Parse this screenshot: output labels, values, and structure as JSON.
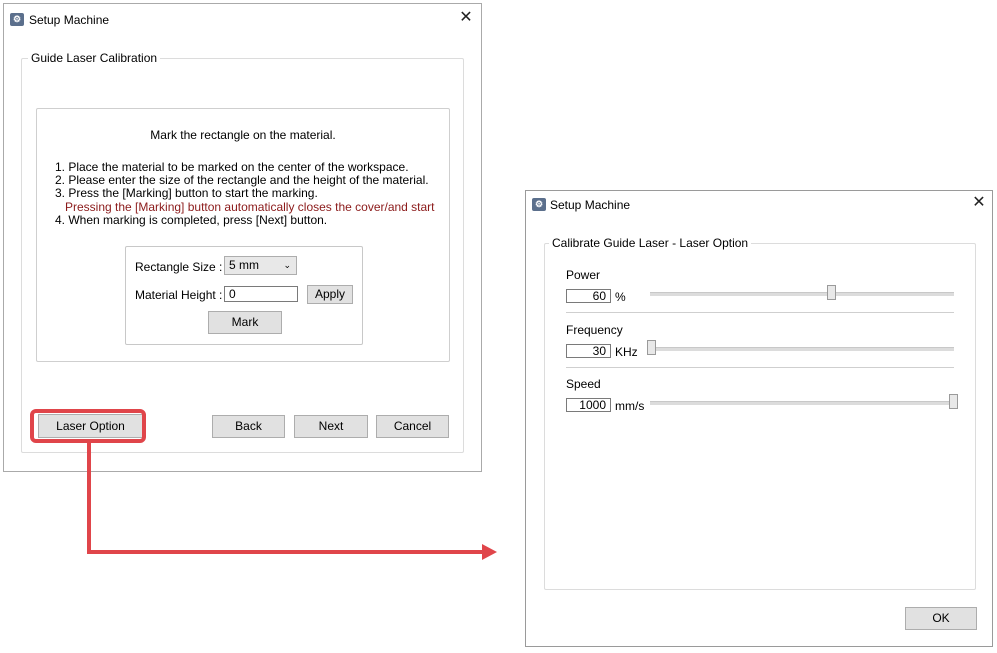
{
  "left_window": {
    "title": "Setup Machine",
    "group_title": "Guide Laser Calibration",
    "heading": "Mark the rectangle on the material.",
    "instructions": [
      "1. Place the material to be marked on the center of the workspace.",
      "2. Please enter the size of the rectangle and the height of the material.",
      "3. Press the [Marking] button to start the marking.",
      "Pressing the [Marking] button automatically closes the cover/and start",
      "4. When marking is completed, press [Next] button."
    ],
    "rect_size_label": "Rectangle Size :",
    "rect_size_value": "5 mm",
    "material_height_label": "Material Height :",
    "material_height_value": "0",
    "apply_label": "Apply",
    "mark_label": "Mark",
    "laser_option_label": "Laser Option",
    "back_label": "Back",
    "next_label": "Next",
    "cancel_label": "Cancel"
  },
  "right_window": {
    "title": "Setup Machine",
    "group_title": "Calibrate Guide Laser - Laser Option",
    "power": {
      "label": "Power",
      "value": "60",
      "unit": "%",
      "slider_fraction": 0.6
    },
    "frequency": {
      "label": "Frequency",
      "value": "30",
      "unit": "KHz",
      "slider_fraction": 0.0
    },
    "speed": {
      "label": "Speed",
      "value": "1000",
      "unit": "mm/s",
      "slider_fraction": 1.0
    },
    "ok_label": "OK"
  },
  "colors": {
    "highlight": "#e0454a",
    "warning_text": "#8b1a1a"
  },
  "icons": {
    "app": "setup-machine-icon",
    "close": "close-icon",
    "dropdown": "chevron-down-icon"
  }
}
